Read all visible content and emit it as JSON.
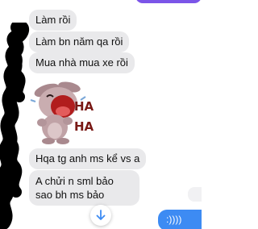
{
  "messages": {
    "incoming": [
      "Làm rồi",
      "Làm bn năm qa rồi",
      "Mua nhà mua xe rồi",
      "Hqa tg anh ms kể vs a",
      "A chửi n sml bảo sao bh ms bảo"
    ],
    "outgoing": [
      ":))))"
    ]
  },
  "sticker": {
    "text_line1": "HA",
    "text_line2": "HA"
  },
  "colors": {
    "incoming_bubble": "#e9e9eb",
    "outgoing_bubble": "#3d8bf3",
    "top_outgoing_bubble": "#7b55e8",
    "scroll_arrow": "#3d8bf3"
  },
  "icons": {
    "scroll_down": "arrow-down-icon"
  }
}
